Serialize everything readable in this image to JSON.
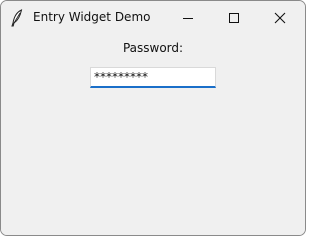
{
  "window": {
    "title": "Entry Widget Demo",
    "icon": "feather-icon",
    "controls": {
      "minimize_icon": "minimize-icon",
      "maximize_icon": "maximize-icon",
      "close_icon": "close-icon"
    }
  },
  "form": {
    "password_label": "Password:",
    "password_value": "*********",
    "accent_color": "#1a6fc9"
  }
}
